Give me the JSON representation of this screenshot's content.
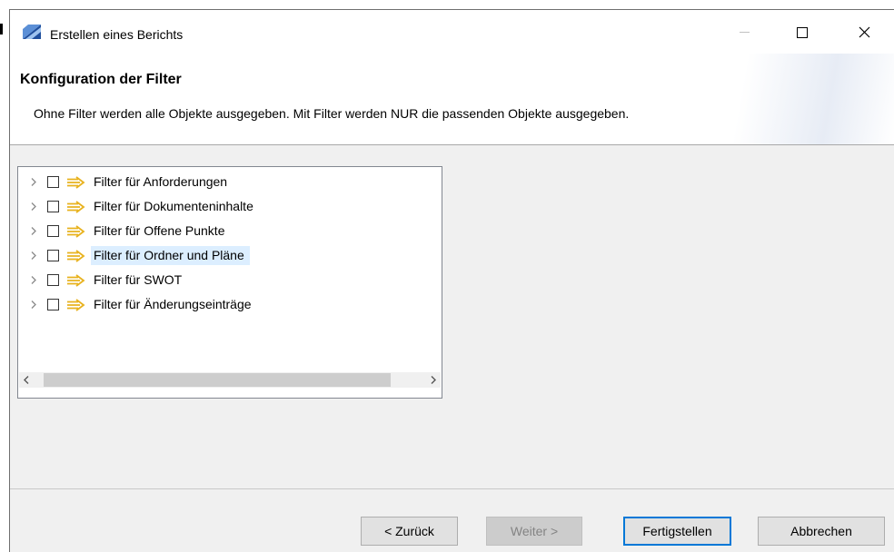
{
  "window": {
    "title": "Erstellen eines Berichts"
  },
  "banner": {
    "title": "Konfiguration der Filter",
    "description": "Ohne Filter werden alle Objekte ausgegeben. Mit Filter werden NUR die passenden Objekte ausgegeben."
  },
  "tree": {
    "items": [
      {
        "label": "Filter für Anforderungen",
        "checked": false,
        "selected": false,
        "icon": "filter-arrow-icon"
      },
      {
        "label": "Filter für Dokumenteninhalte",
        "checked": false,
        "selected": false,
        "icon": "filter-arrow-icon"
      },
      {
        "label": "Filter für Offene Punkte",
        "checked": false,
        "selected": false,
        "icon": "filter-arrow-icon"
      },
      {
        "label": "Filter für Ordner und Pläne",
        "checked": false,
        "selected": true,
        "icon": "filter-arrow-icon"
      },
      {
        "label": "Filter für SWOT",
        "checked": false,
        "selected": false,
        "icon": "filter-arrow-icon"
      },
      {
        "label": "Filter für Änderungseinträge",
        "checked": false,
        "selected": false,
        "icon": "filter-arrow-icon"
      }
    ]
  },
  "buttons": {
    "back": "< Zurück",
    "next": "Weiter >",
    "finish": "Fertigstellen",
    "cancel": "Abbrechen"
  },
  "colors": {
    "accent": "#0078d7",
    "selection": "#dceeff",
    "icon_arrow": "#e8b21e"
  }
}
